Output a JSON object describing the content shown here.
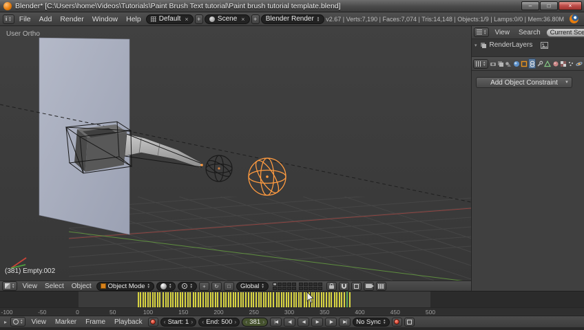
{
  "window": {
    "title": "Blender* [C:\\Users\\home\\Videos\\Tutorials\\Paint Brush Text tutorial\\Paint brush tutorial template.blend]"
  },
  "info": {
    "menus": [
      "File",
      "Add",
      "Render",
      "Window",
      "Help"
    ],
    "layout": "Default",
    "scene": "Scene",
    "engine": "Blender Render",
    "stats": "v2.67 | Verts:7,190 | Faces:7,074 | Tris:14,148 | Objects:1/9 | Lamps:0/0 | Mem:36.80M"
  },
  "viewport": {
    "view_label": "User Ortho",
    "object_label": "(381) Empty.002",
    "header": {
      "menus": [
        "View",
        "Select",
        "Object"
      ],
      "mode": "Object Mode",
      "orientation": "Global"
    }
  },
  "outliner": {
    "menus": [
      "View",
      "Search"
    ],
    "display_mode": "Current Scene",
    "items": [
      {
        "label": "RenderLayers"
      }
    ]
  },
  "properties": {
    "tabs": [
      "Render",
      "Render Layers",
      "Scene",
      "World",
      "Object",
      "Constraints",
      "Modifiers",
      "Object Data",
      "Material",
      "Texture",
      "Particles",
      "Physics"
    ],
    "active_tab": "Constraints",
    "add_button": "Add Object Constraint"
  },
  "timeline": {
    "menus": [
      "View",
      "Marker",
      "Frame",
      "Playback"
    ],
    "start": "Start: 1",
    "end": "End: 500",
    "current_frame": "381",
    "sync": "No Sync",
    "frame_range": {
      "start": 1,
      "end": 500
    },
    "ruler_labels": [
      -100,
      -50,
      0,
      50,
      100,
      150,
      200,
      250,
      300,
      350,
      400,
      450,
      500
    ],
    "keyframes": [
      85,
      88,
      92,
      95,
      99,
      102,
      106,
      109,
      113,
      116,
      120,
      124,
      127,
      131,
      134,
      138,
      141,
      145,
      148,
      152,
      156,
      159,
      163,
      166,
      170,
      173,
      177,
      181,
      184,
      188,
      191,
      195,
      198,
      202,
      206,
      209,
      213,
      216,
      220,
      223,
      227,
      231,
      234,
      238,
      241,
      245,
      248,
      252,
      256,
      259,
      263,
      266,
      270,
      273,
      277,
      281,
      284,
      288,
      291,
      295,
      298,
      302,
      306,
      309,
      313,
      316,
      320,
      323,
      327,
      331,
      334,
      338,
      341,
      345,
      348,
      352,
      356,
      359,
      363,
      366,
      370,
      373,
      377,
      381,
      385
    ],
    "colors": {
      "keyframe": "#d8d441",
      "playhead": "#58a858"
    }
  },
  "colors": {
    "accent_orange": "#e87d0d",
    "selection_orange": "#ff9b40"
  }
}
